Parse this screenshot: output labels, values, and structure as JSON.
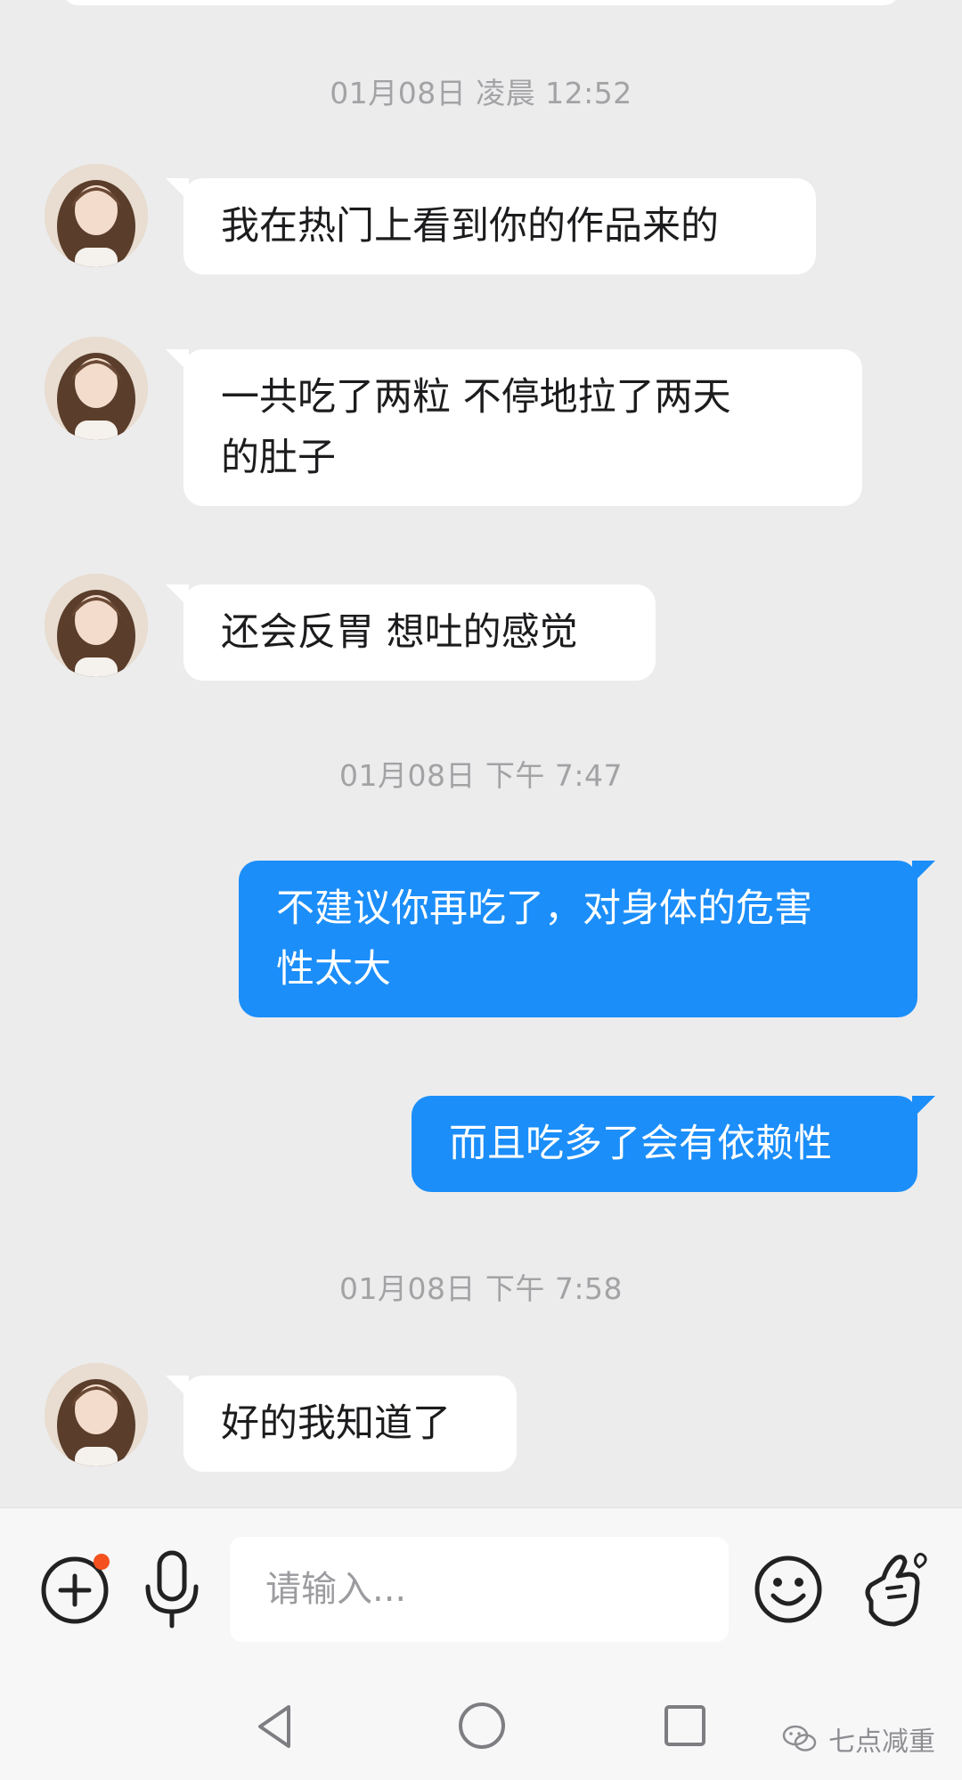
{
  "conversation": {
    "timestamps": [
      "01月08日 凌晨 12:52",
      "01月08日 下午 7:47",
      "01月08日 下午 7:58"
    ],
    "messages": [
      {
        "from": "other",
        "text": "我在热门上看到你的作品来的"
      },
      {
        "from": "other",
        "text": "一共吃了两粒 不停地拉了两天\n的肚子"
      },
      {
        "from": "other",
        "text": "还会反胃 想吐的感觉"
      },
      {
        "from": "me",
        "text": "不建议你再吃了，对身体的危害\n性太大"
      },
      {
        "from": "me",
        "text": "而且吃多了会有依赖性"
      },
      {
        "from": "other",
        "text": "好的我知道了"
      }
    ]
  },
  "composer": {
    "placeholder": "请输入...",
    "icons": [
      "add-circle-icon",
      "microphone-icon",
      "emoji-icon",
      "finger-heart-icon"
    ],
    "add_badge_color": "#f4511e"
  },
  "navigation": {
    "icons": [
      "back-triangle-icon",
      "home-circle-icon",
      "recents-square-icon"
    ]
  },
  "watermark": {
    "text": "七点减重",
    "icon": "wechat-icon"
  },
  "colors": {
    "background": "#ececed",
    "incoming_bubble": "#ffffff",
    "outgoing_bubble": "#1b8ef9",
    "timestamp_text": "#a3a3a6"
  }
}
